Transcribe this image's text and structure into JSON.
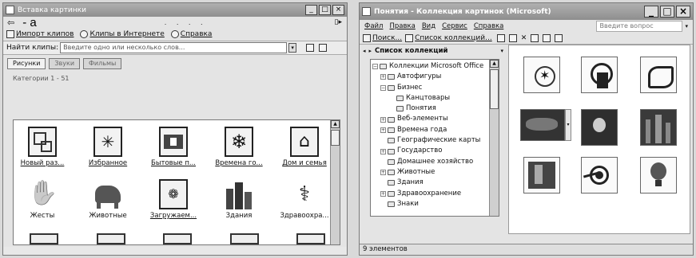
{
  "left_window": {
    "title": "Вставка картинки",
    "title_buttons": [
      "_",
      "□",
      "×"
    ],
    "doodle_text": "- a",
    "toolbar": {
      "import_label": "Импорт клипов",
      "online_label": "Клипы в Интернете",
      "help_label": "Справка"
    },
    "search": {
      "label": "Найти клипы:",
      "placeholder": "Введите одно или несколько слов..."
    },
    "tabs": [
      "Рисунки",
      "Звуки",
      "Фильмы"
    ],
    "category_header": "Категории 1 - 51",
    "tiles": [
      {
        "label": "Новый раз...",
        "link": true,
        "icon": "new-category-icon"
      },
      {
        "label": "Избранное",
        "link": true,
        "icon": "favorites-icon"
      },
      {
        "label": "Бытовые п...",
        "link": true,
        "icon": "household-icon"
      },
      {
        "label": "Времена го...",
        "link": true,
        "icon": "seasons-icon"
      },
      {
        "label": "Дом и семья",
        "link": true,
        "icon": "home-family-icon"
      },
      {
        "label": "Жесты",
        "link": false,
        "icon": "gestures-icon"
      },
      {
        "label": "Животные",
        "link": false,
        "icon": "animals-icon"
      },
      {
        "label": "Загружаем...",
        "link": true,
        "icon": "downloaded-icon"
      },
      {
        "label": "Здания",
        "link": false,
        "icon": "buildings-icon"
      },
      {
        "label": "Здравоохра...",
        "link": false,
        "icon": "healthcare-icon"
      }
    ]
  },
  "right_window": {
    "title": "Понятия - Коллекция картинок (Microsoft)",
    "title_buttons": [
      "_",
      "□",
      "×"
    ],
    "menu": [
      "Файл",
      "Правка",
      "Вид",
      "Сервис",
      "Справка"
    ],
    "question_placeholder": "Введите вопрос",
    "toolbar": {
      "search_label": "Поиск...",
      "collections_label": "Список коллекций..."
    },
    "collection_header": "Список коллекций",
    "tree": [
      {
        "label": "Коллекции Microsoft Office",
        "level": 0,
        "toggle": "−"
      },
      {
        "label": "Автофигуры",
        "level": 1,
        "toggle": "+"
      },
      {
        "label": "Бизнес",
        "level": 1,
        "toggle": "−"
      },
      {
        "label": "Канцтовары",
        "level": 2,
        "toggle": ""
      },
      {
        "label": "Понятия",
        "level": 2,
        "toggle": ""
      },
      {
        "label": "Веб-элементы",
        "level": 1,
        "toggle": "+"
      },
      {
        "label": "Времена года",
        "level": 1,
        "toggle": "+"
      },
      {
        "label": "Географические карты",
        "level": 1,
        "toggle": ""
      },
      {
        "label": "Государство",
        "level": 1,
        "toggle": "+"
      },
      {
        "label": "Домашнее хозяйство",
        "level": 1,
        "toggle": ""
      },
      {
        "label": "Животные",
        "level": 1,
        "toggle": "+"
      },
      {
        "label": "Здания",
        "level": 1,
        "toggle": ""
      },
      {
        "label": "Здравоохранение",
        "level": 1,
        "toggle": "+"
      },
      {
        "label": "Знаки",
        "level": 1,
        "toggle": ""
      }
    ],
    "clips": [
      "runner-clip-icon",
      "chess-clip-icon",
      "puzzle-clip-icon",
      "stars-clip-icon",
      "lightbulb-clip-icon",
      "city-night-clip-icon",
      "books-clip-icon",
      "target-clip-icon",
      "balloon-clip-icon"
    ],
    "status_text": "9 элементов"
  }
}
